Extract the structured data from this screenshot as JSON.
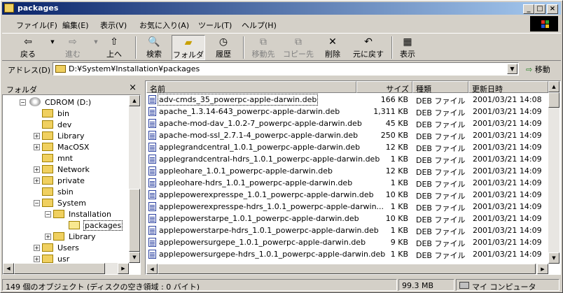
{
  "window": {
    "title": "packages"
  },
  "menu": [
    "ファイル(F)",
    "編集(E)",
    "表示(V)",
    "お気に入り(A)",
    "ツール(T)",
    "ヘルプ(H)"
  ],
  "toolbar": {
    "back": "戻る",
    "forward": "進む",
    "up": "上へ",
    "search": "検索",
    "folders": "フォルダ",
    "history": "履歴",
    "moveto": "移動先",
    "copyto": "コピー先",
    "delete": "削除",
    "undo": "元に戻す",
    "views": "表示"
  },
  "address": {
    "label": "アドレス(D)",
    "path": "D:¥System¥Installation¥packages",
    "go": "移動"
  },
  "folders_pane": {
    "title": "フォルダ",
    "drive": "CDROM (D:)",
    "items": [
      "bin",
      "dev",
      "Library",
      "MacOSX",
      "mnt",
      "Network",
      "private",
      "sbin",
      "System",
      "Installation",
      "packages",
      "Library",
      "Users",
      "usr"
    ]
  },
  "columns": {
    "name": "名前",
    "size": "サイズ",
    "type": "種類",
    "date": "更新日時"
  },
  "files": [
    {
      "name": "adv-cmds_35_powerpc-apple-darwin.deb",
      "size": "166 KB",
      "type": "DEB ファイル",
      "date": "2001/03/21 14:08"
    },
    {
      "name": "apache_1.3.14-643_powerpc-apple-darwin.deb",
      "size": "1,311 KB",
      "type": "DEB ファイル",
      "date": "2001/03/21 14:09"
    },
    {
      "name": "apache-mod-dav_1.0.2-7_powerpc-apple-darwin.deb",
      "size": "45 KB",
      "type": "DEB ファイル",
      "date": "2001/03/21 14:09"
    },
    {
      "name": "apache-mod-ssl_2.7.1-4_powerpc-apple-darwin.deb",
      "size": "250 KB",
      "type": "DEB ファイル",
      "date": "2001/03/21 14:09"
    },
    {
      "name": "applegrandcentral_1.0.1_powerpc-apple-darwin.deb",
      "size": "12 KB",
      "type": "DEB ファイル",
      "date": "2001/03/21 14:09"
    },
    {
      "name": "applegrandcentral-hdrs_1.0.1_powerpc-apple-darwin.deb",
      "size": "1 KB",
      "type": "DEB ファイル",
      "date": "2001/03/21 14:09"
    },
    {
      "name": "appleohare_1.0.1_powerpc-apple-darwin.deb",
      "size": "12 KB",
      "type": "DEB ファイル",
      "date": "2001/03/21 14:09"
    },
    {
      "name": "appleohare-hdrs_1.0.1_powerpc-apple-darwin.deb",
      "size": "1 KB",
      "type": "DEB ファイル",
      "date": "2001/03/21 14:09"
    },
    {
      "name": "applepowerexpresspe_1.0.1_powerpc-apple-darwin.deb",
      "size": "10 KB",
      "type": "DEB ファイル",
      "date": "2001/03/21 14:09"
    },
    {
      "name": "applepowerexpresspe-hdrs_1.0.1_powerpc-apple-darwin...",
      "size": "1 KB",
      "type": "DEB ファイル",
      "date": "2001/03/21 14:09"
    },
    {
      "name": "applepowerstarpe_1.0.1_powerpc-apple-darwin.deb",
      "size": "10 KB",
      "type": "DEB ファイル",
      "date": "2001/03/21 14:09"
    },
    {
      "name": "applepowerstarpe-hdrs_1.0.1_powerpc-apple-darwin.deb",
      "size": "1 KB",
      "type": "DEB ファイル",
      "date": "2001/03/21 14:09"
    },
    {
      "name": "applepowersurgepe_1.0.1_powerpc-apple-darwin.deb",
      "size": "9 KB",
      "type": "DEB ファイル",
      "date": "2001/03/21 14:09"
    },
    {
      "name": "applepowersurgepe-hdrs_1.0.1_powerpc-apple-darwin.deb",
      "size": "1 KB",
      "type": "DEB ファイル",
      "date": "2001/03/21 14:09"
    }
  ],
  "status": {
    "objects": "149 個のオブジェクト (ディスクの空き領域 : 0 バイト)",
    "size": "99.3 MB",
    "location": "マイ コンピュータ"
  }
}
